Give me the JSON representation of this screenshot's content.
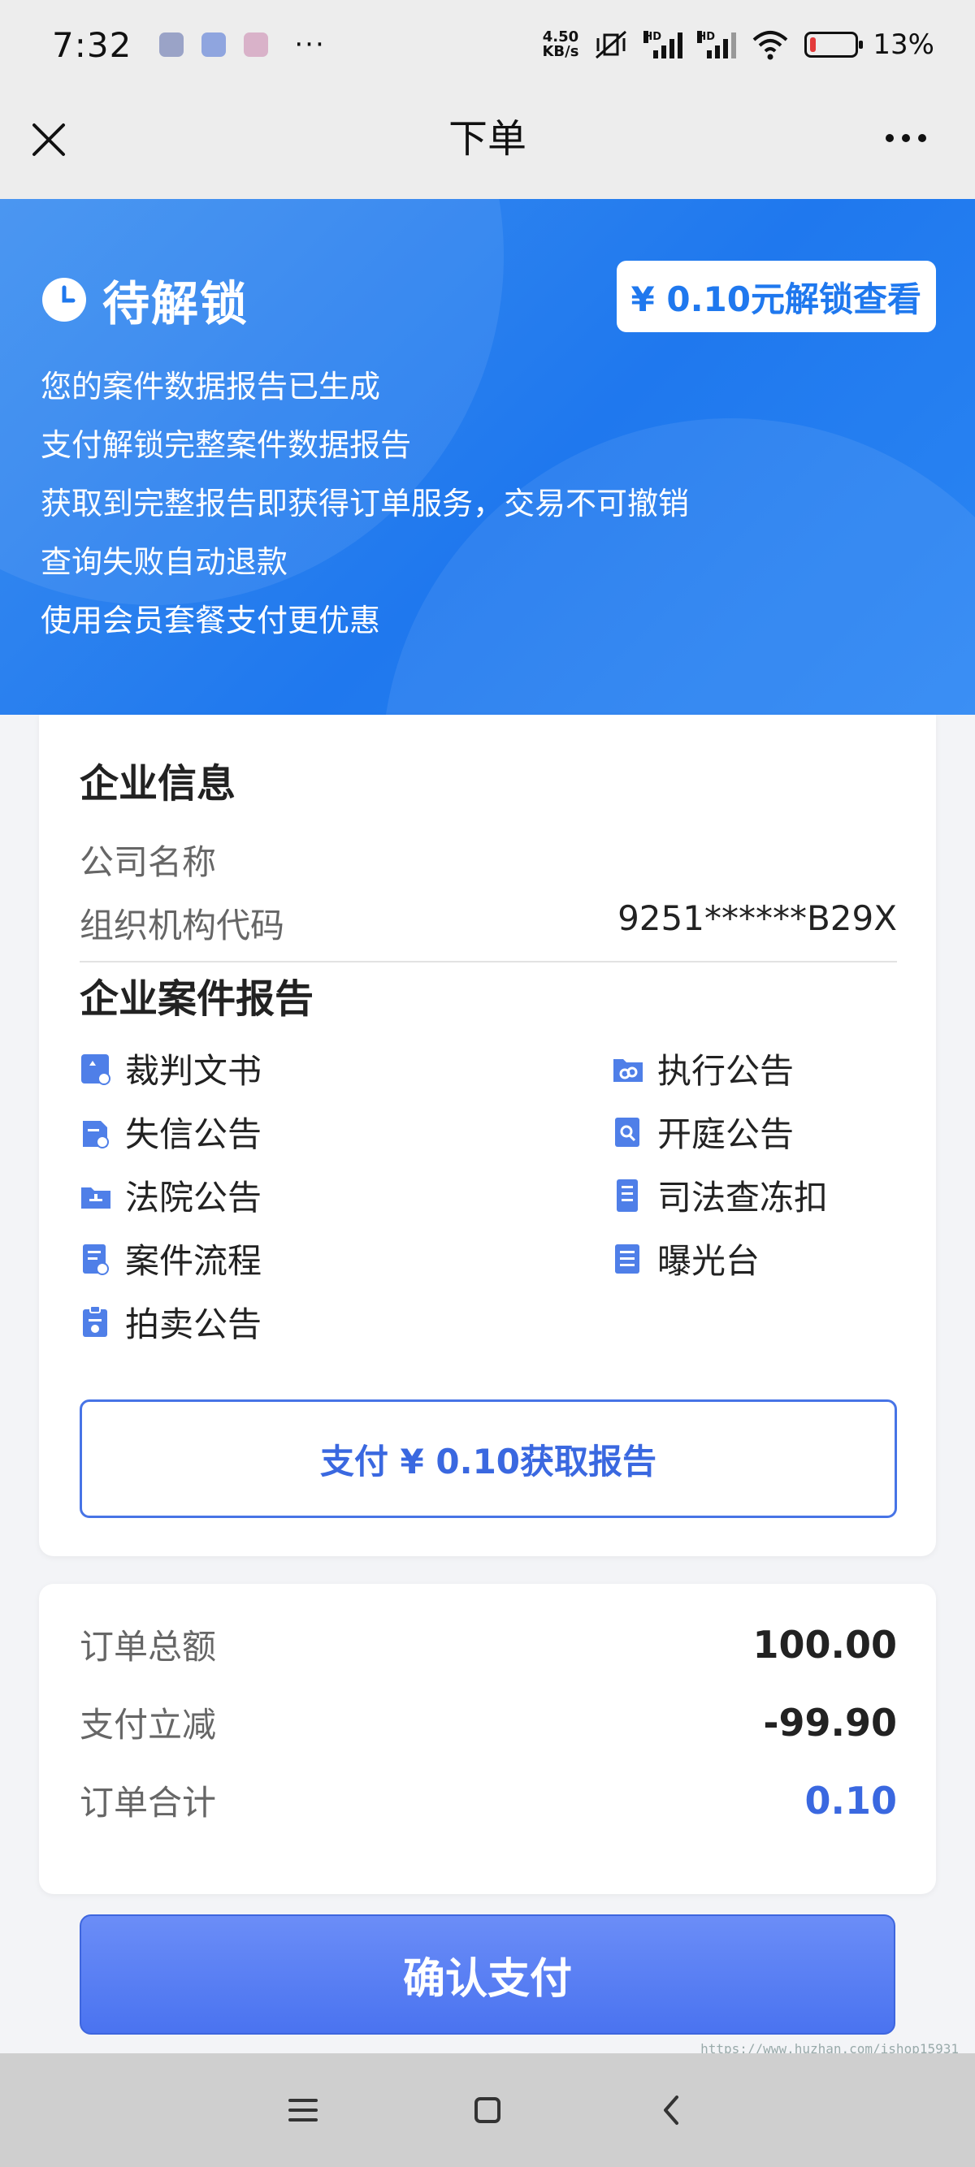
{
  "status_bar": {
    "time": "7:32",
    "notif_dots": "···",
    "net_speed_value": "4.50",
    "net_speed_unit": "KB/s",
    "hd1": "HD",
    "hd2": "HD",
    "battery_pct": "13%",
    "battery_level": 0.13
  },
  "title_bar": {
    "title": "下单"
  },
  "banner": {
    "title": "待解锁",
    "unlock_button": "¥ 0.10元解锁查看",
    "lines": [
      "您的案件数据报告已生成",
      "支付解锁完整案件数据报告",
      "获取到完整报告即获得订单服务，交易不可撤销",
      "查询失败自动退款",
      "使用会员套餐支付更优惠"
    ]
  },
  "company_info": {
    "title": "企业信息",
    "rows": [
      {
        "label": "公司名称",
        "value": ""
      },
      {
        "label": "组织机构代码",
        "value": "9251******B29X"
      }
    ]
  },
  "case_report": {
    "title": "企业案件报告",
    "items": [
      {
        "label": "裁判文书",
        "icon": "judgment-doc-icon"
      },
      {
        "label": "执行公告",
        "icon": "execution-notice-icon"
      },
      {
        "label": "失信公告",
        "icon": "dishonest-notice-icon"
      },
      {
        "label": "开庭公告",
        "icon": "court-session-icon"
      },
      {
        "label": "法院公告",
        "icon": "court-notice-icon"
      },
      {
        "label": "司法查冻扣",
        "icon": "judicial-freeze-icon"
      },
      {
        "label": "案件流程",
        "icon": "case-process-icon"
      },
      {
        "label": "曝光台",
        "icon": "exposure-icon"
      },
      {
        "label": "拍卖公告",
        "icon": "auction-notice-icon"
      }
    ],
    "button": "支付 ¥ 0.10获取报告"
  },
  "order": {
    "rows": [
      {
        "label": "订单总额",
        "value": "100.00"
      },
      {
        "label": "支付立减",
        "value": "-99.90"
      },
      {
        "label": "订单合计",
        "value": "0.10"
      }
    ]
  },
  "confirm_button": "确认支付",
  "watermark": "https://www.huzhan.com/ishop15931",
  "colors": {
    "primary": "#1f78ee",
    "accent_blue": "#3a68e0",
    "battery_low": "#e33b3b"
  }
}
